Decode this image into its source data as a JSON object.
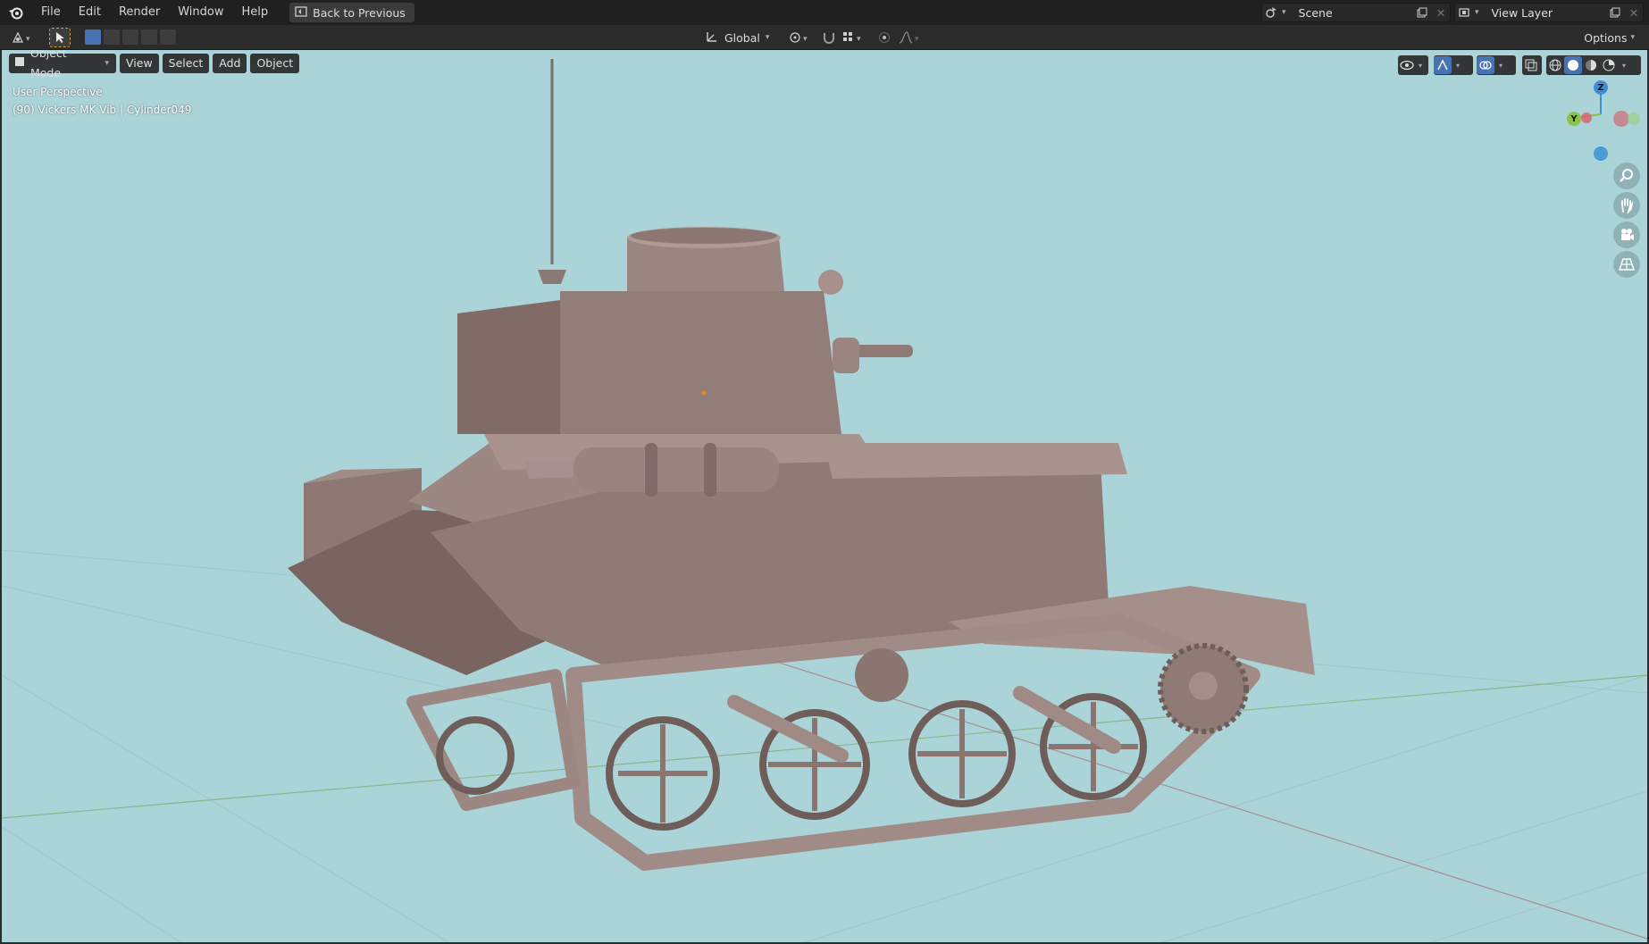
{
  "menu": {
    "items": [
      "File",
      "Edit",
      "Render",
      "Window",
      "Help"
    ],
    "back_button": "Back to Previous"
  },
  "header_right": {
    "scene_name": "Scene",
    "view_layer_name": "View Layer"
  },
  "toolbar": {
    "transform_orientation": "Global",
    "options_label": "Options"
  },
  "viewport": {
    "mode": "Object Mode",
    "menus": [
      "View",
      "Select",
      "Add",
      "Object"
    ],
    "perspective_label": "User Perspective",
    "object_info": "(90) Vickers MK Vib | Cylinder049",
    "background_color": "#abd4d9",
    "model_color": "#8f7a76"
  },
  "gizmo": {
    "axes": [
      "Z",
      "Y",
      "X"
    ],
    "colors": {
      "x": "#e05a6b",
      "y": "#8bc34a",
      "z": "#3e8fd8"
    }
  },
  "nav_icons": [
    "zoom-icon",
    "pan-hand-icon",
    "camera-icon",
    "perspective-grid-icon"
  ]
}
